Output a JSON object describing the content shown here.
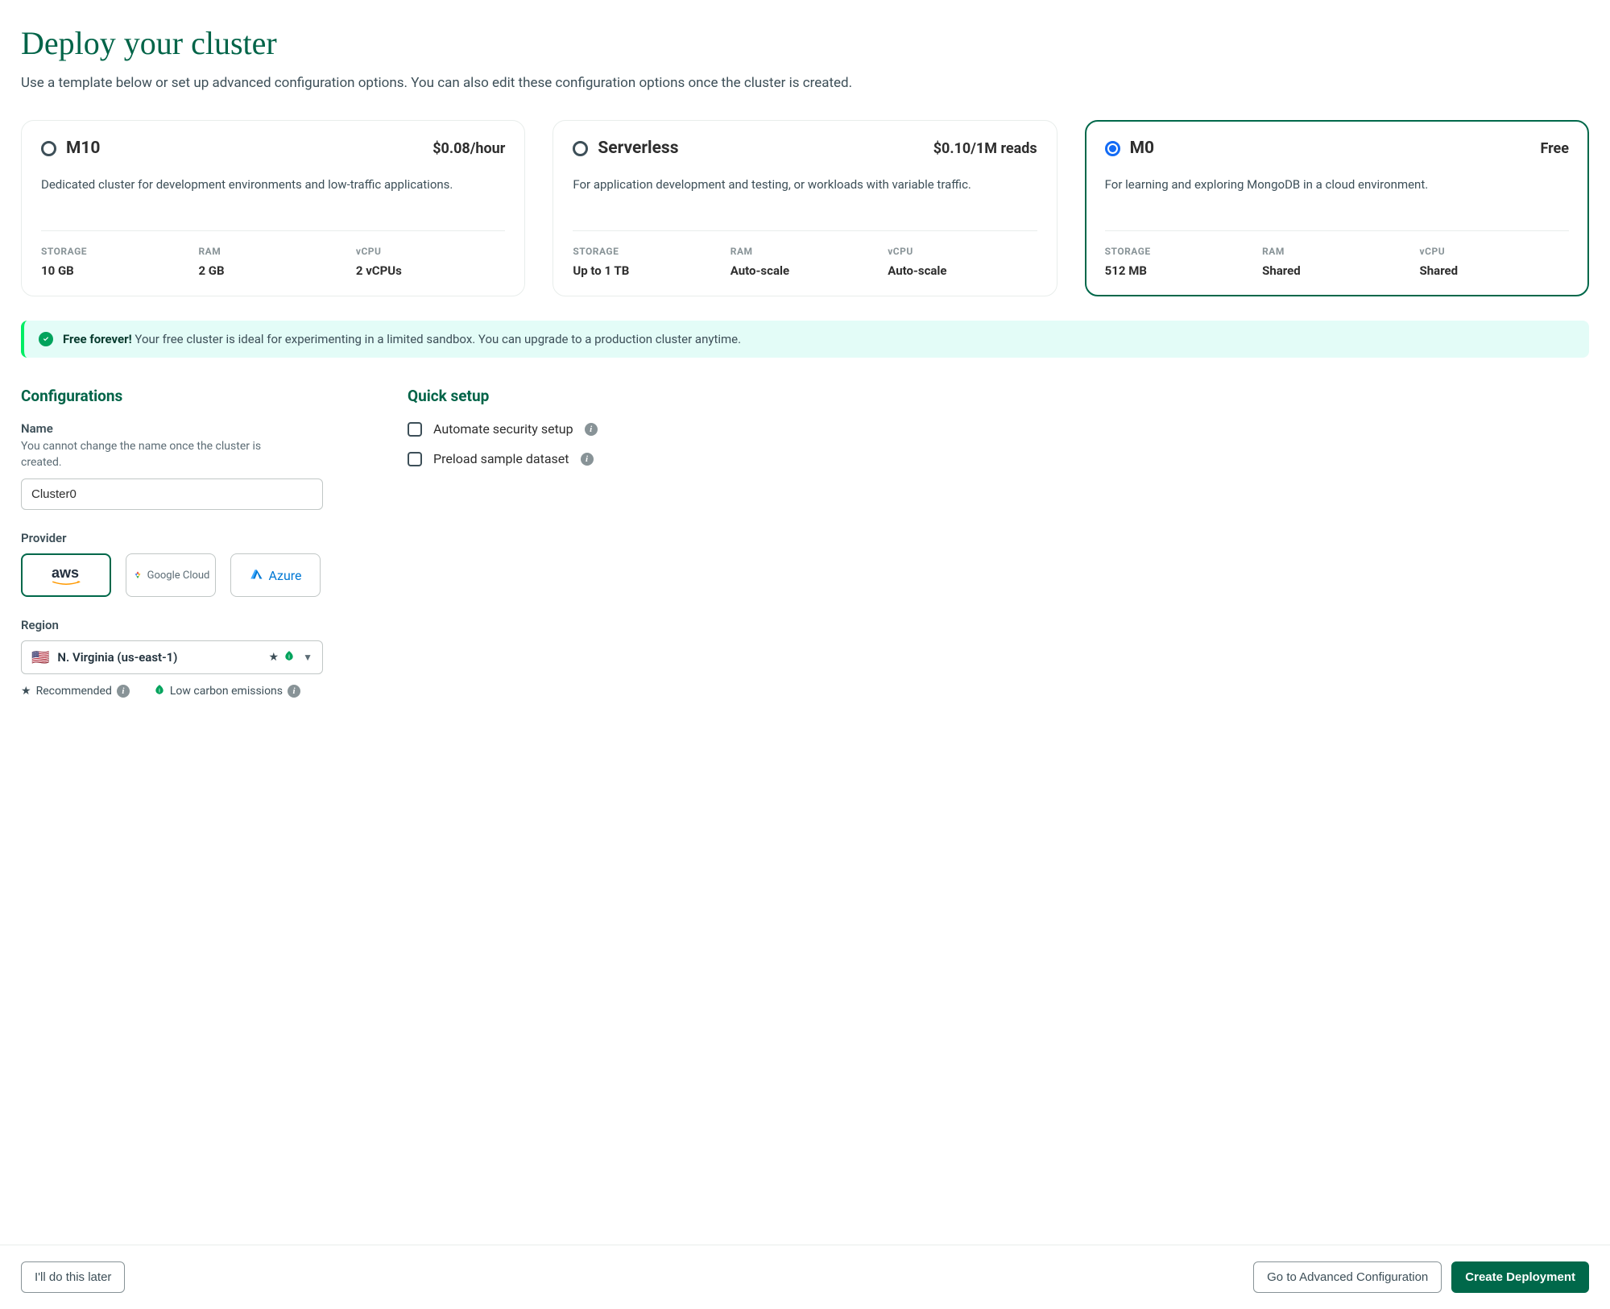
{
  "title": "Deploy your cluster",
  "subtitle": "Use a template below or set up advanced configuration options. You can also edit these configuration options once the cluster is created.",
  "tiers": [
    {
      "name": "M10",
      "price": "$0.08/hour",
      "desc": "Dedicated cluster for development environments and low-traffic applications.",
      "specs": {
        "storage_label": "STORAGE",
        "storage": "10 GB",
        "ram_label": "RAM",
        "ram": "2 GB",
        "vcpu_label": "vCPU",
        "vcpu": "2 vCPUs"
      }
    },
    {
      "name": "Serverless",
      "price": "$0.10/1M reads",
      "desc": "For application development and testing, or workloads with variable traffic.",
      "specs": {
        "storage_label": "STORAGE",
        "storage": "Up to 1 TB",
        "ram_label": "RAM",
        "ram": "Auto-scale",
        "vcpu_label": "vCPU",
        "vcpu": "Auto-scale"
      }
    },
    {
      "name": "M0",
      "price": "Free",
      "desc": "For learning and exploring MongoDB in a cloud environment.",
      "specs": {
        "storage_label": "STORAGE",
        "storage": "512 MB",
        "ram_label": "RAM",
        "ram": "Shared",
        "vcpu_label": "vCPU",
        "vcpu": "Shared"
      }
    }
  ],
  "banner": {
    "strong": "Free forever!",
    "text": "Your free cluster is ideal for experimenting in a limited sandbox. You can upgrade to a production cluster anytime."
  },
  "config": {
    "section_title": "Configurations",
    "name_label": "Name",
    "name_help": "You cannot change the name once the cluster is created.",
    "name_value": "Cluster0",
    "provider_label": "Provider",
    "providers": {
      "aws": "aws",
      "gcp": "Google Cloud",
      "azure": "Azure"
    },
    "region_label": "Region",
    "region_value": "N. Virginia (us-east-1)",
    "legend_recommended": "Recommended",
    "legend_low_carbon": "Low carbon emissions"
  },
  "quick": {
    "section_title": "Quick setup",
    "opt_security": "Automate security setup",
    "opt_sample": "Preload sample dataset"
  },
  "footer": {
    "later": "I'll do this later",
    "advanced": "Go to Advanced Configuration",
    "create": "Create Deployment"
  }
}
